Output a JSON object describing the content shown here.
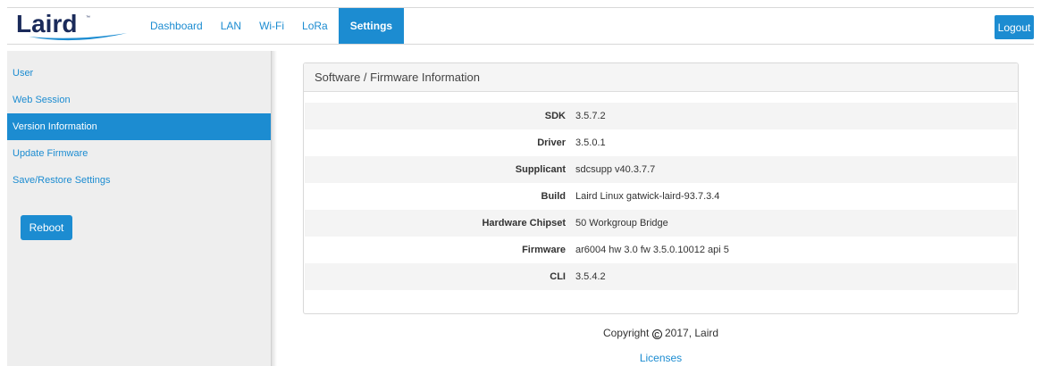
{
  "brand": {
    "logo_text": "Laird",
    "accent": "#1c8cd1"
  },
  "nav": {
    "links": [
      {
        "label": "Dashboard"
      },
      {
        "label": "LAN"
      },
      {
        "label": "Wi-Fi"
      },
      {
        "label": "LoRa"
      },
      {
        "label": "Settings",
        "active": true
      }
    ],
    "logout_label": "Logout"
  },
  "sidebar": {
    "items": [
      {
        "label": "User"
      },
      {
        "label": "Web Session"
      },
      {
        "label": "Version Information",
        "active": true
      },
      {
        "label": "Update Firmware"
      },
      {
        "label": "Save/Restore Settings"
      }
    ],
    "reboot_label": "Reboot"
  },
  "panel": {
    "title": "Software / Firmware Information",
    "rows": [
      {
        "label": "SDK",
        "value": "3.5.7.2"
      },
      {
        "label": "Driver",
        "value": "3.5.0.1"
      },
      {
        "label": "Supplicant",
        "value": "sdcsupp v40.3.7.7"
      },
      {
        "label": "Build",
        "value": "Laird Linux gatwick-laird-93.7.3.4"
      },
      {
        "label": "Hardware Chipset",
        "value": "50 Workgroup Bridge"
      },
      {
        "label": "Firmware",
        "value": "ar6004 hw 3.0 fw 3.5.0.10012 api 5"
      },
      {
        "label": "CLI",
        "value": "3.5.4.2"
      }
    ]
  },
  "footer": {
    "copyright_prefix": "Copyright",
    "copyright_symbol": "C",
    "copyright_suffix": "2017, Laird",
    "licenses_label": "Licenses"
  }
}
